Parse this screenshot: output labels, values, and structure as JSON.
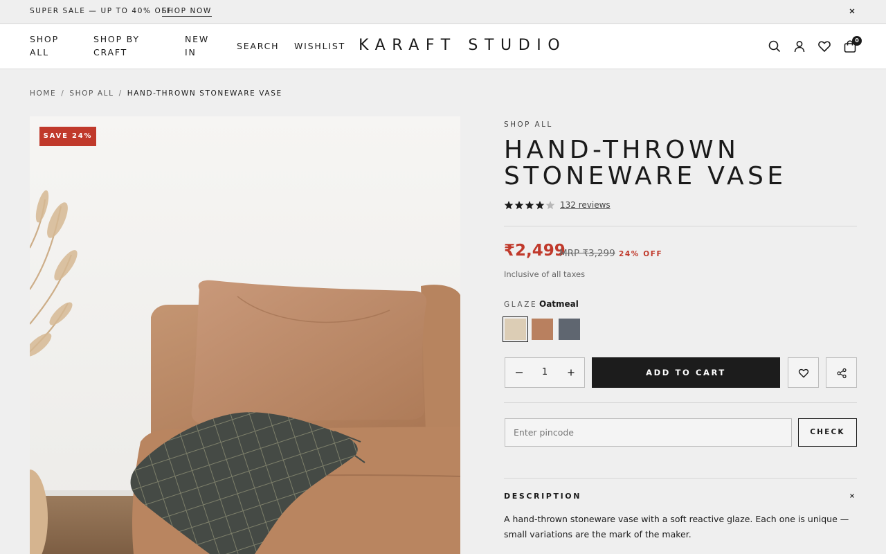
{
  "announcement": {
    "message": "SUPER SALE — UP TO 40% OFF",
    "link": "SHOP NOW"
  },
  "header": {
    "nav": [
      "SHOP\nALL",
      "SHOP BY\nCRAFT",
      "NEW\nIN",
      "SEARCH",
      "WISHLIST"
    ],
    "nav_shop_all_1": "SHOP",
    "nav_shop_all_2": "ALL",
    "nav_shop_by_1": "SHOP BY",
    "nav_shop_by_2": "CRAFT",
    "nav_new_1": "NEW",
    "nav_new_2": "IN",
    "nav_search": "SEARCH",
    "nav_wishlist": "WISHLIST",
    "logo": "KARAFT STUDIO",
    "cart_count": "0"
  },
  "breadcrumb": {
    "home": "HOME",
    "category": "SHOP ALL",
    "current": "HAND-THROWN STONEWARE VASE",
    "separator": "/"
  },
  "product": {
    "badge": "SAVE 24%",
    "eyebrow": "SHOP ALL",
    "title": "HAND-THROWN STONEWARE VASE",
    "rating": 4,
    "rating_max": 5,
    "reviews_label": "132 reviews",
    "price": "₹2,499",
    "mrp": "MRP ₹3,299",
    "discount": "24% OFF",
    "tax_note": "Inclusive of all taxes",
    "glaze_label": "GLAZE",
    "glaze_selected": "Oatmeal",
    "swatches": [
      {
        "name": "Oatmeal",
        "color": "#dccdb5"
      },
      {
        "name": "Terracotta",
        "color": "#b9805f"
      },
      {
        "name": "Slate",
        "color": "#5f6670"
      }
    ],
    "quantity": "1",
    "add_to_cart": "ADD TO CART",
    "pincode_placeholder": "Enter pincode",
    "check_label": "CHECK",
    "description_heading": "DESCRIPTION",
    "description": "A hand-thrown stoneware vase with a soft reactive glaze. Each one is unique — small variations are the mark of the maker."
  },
  "colors": {
    "accent": "#c0392b",
    "dark": "#1c1c1c"
  },
  "icons": [
    "close-icon",
    "search-icon",
    "user-icon",
    "heart-icon",
    "bag-icon",
    "star-icon",
    "minus-icon",
    "plus-icon",
    "share-icon"
  ]
}
